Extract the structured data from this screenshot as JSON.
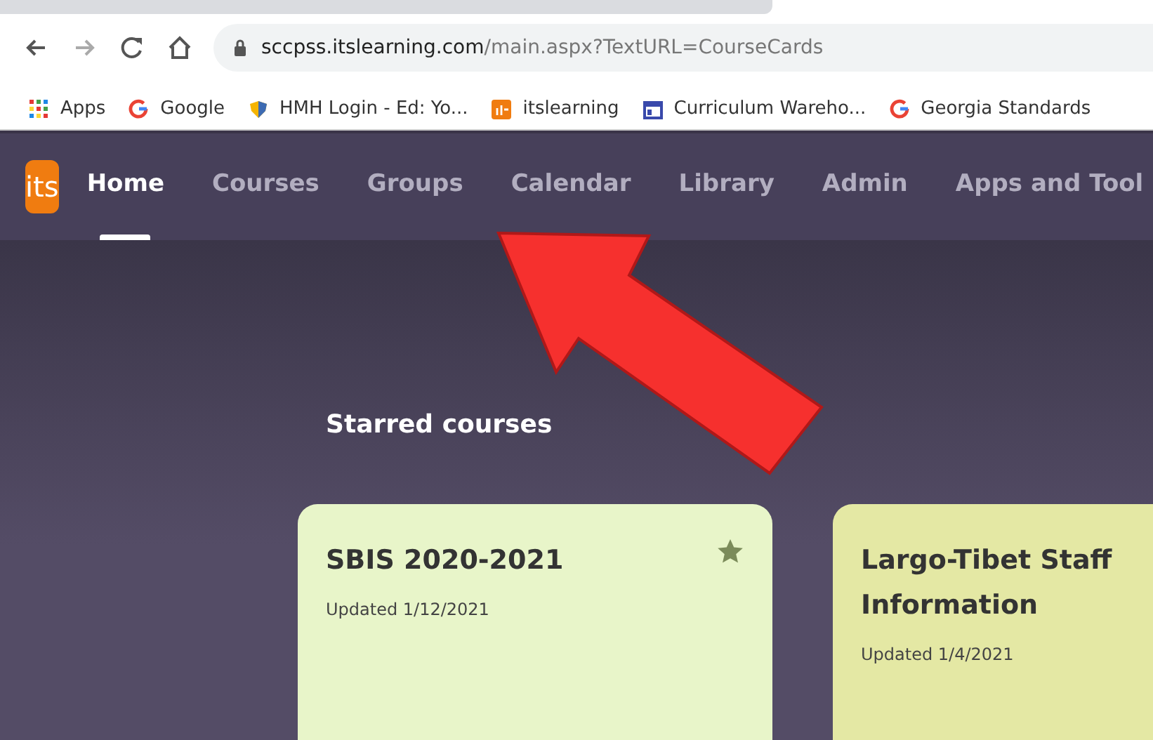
{
  "browser": {
    "url_host": "sccpss.itslearning.com",
    "url_path": "/main.aspx?TextURL=CourseCards",
    "bookmarks": [
      {
        "label": "Apps",
        "kind": "apps"
      },
      {
        "label": "Google",
        "kind": "google"
      },
      {
        "label": "HMH Login - Ed: Yo...",
        "kind": "shield"
      },
      {
        "label": "itslearning",
        "kind": "its"
      },
      {
        "label": "Curriculum Wareho...",
        "kind": "calendar"
      },
      {
        "label": "Georgia Standards",
        "kind": "google"
      }
    ]
  },
  "logo": "its",
  "nav": [
    {
      "label": "Home",
      "selected": true
    },
    {
      "label": "Courses",
      "selected": false
    },
    {
      "label": "Groups",
      "selected": false
    },
    {
      "label": "Calendar",
      "selected": false
    },
    {
      "label": "Library",
      "selected": false
    },
    {
      "label": "Admin",
      "selected": false
    },
    {
      "label": "Apps and Tool",
      "selected": false
    }
  ],
  "section_title": "Starred courses",
  "courses": [
    {
      "title": "SBIS 2020-2021",
      "updated": "Updated 1/12/2021",
      "starred": true,
      "color": "#e8f5c9"
    },
    {
      "title": "Largo-Tibet Staff Information",
      "updated": "Updated 1/4/2021",
      "color": "#e4e8a4"
    }
  ],
  "annotation": {
    "kind": "arrow"
  }
}
